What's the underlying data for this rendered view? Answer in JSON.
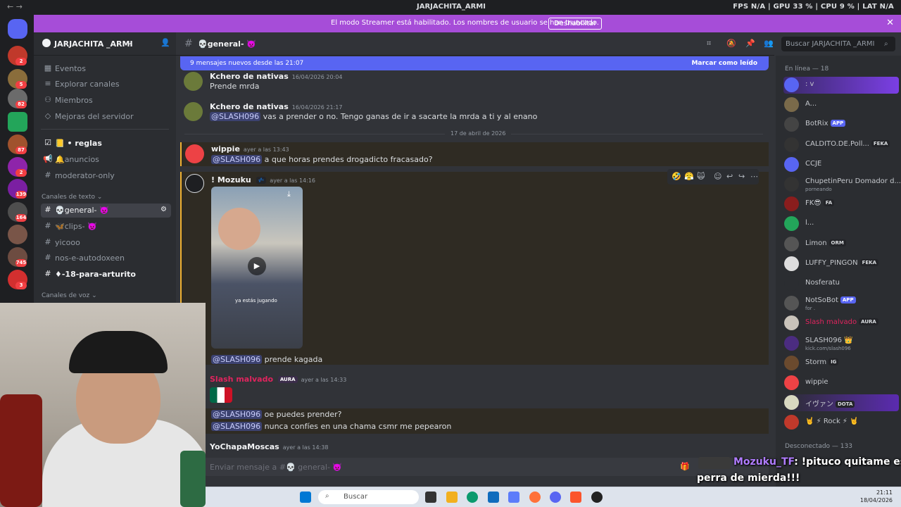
{
  "window": {
    "title": "JARJACHITA_ARMI",
    "stats": "FPS N/A | GPU 33 % | CPU 9 % | LAT N/A"
  },
  "banner": {
    "text": "El modo Streamer está habilitado. Los nombres de usuario se han truncado.",
    "button": "Deshabilitar"
  },
  "server": {
    "name": "JARJACHITA _ARMI",
    "badges": [
      "2",
      "5",
      "82",
      "87",
      "2",
      "139",
      "164",
      "745",
      "3"
    ]
  },
  "sidebar": {
    "top_items": [
      {
        "icon": "calendar-icon",
        "label": "Eventos"
      },
      {
        "icon": "compass-icon",
        "label": "Explorar canales"
      },
      {
        "icon": "members-icon",
        "label": "Miembros"
      },
      {
        "icon": "boost-icon",
        "label": "Mejoras del servidor"
      }
    ],
    "channels_top": [
      {
        "icon": "rules-icon",
        "label": "📒 • reglas"
      },
      {
        "icon": "announce-icon",
        "label": "🔔anuncios"
      },
      {
        "icon": "hash-icon",
        "label": "moderator-only"
      }
    ],
    "text_category": "Canales de texto",
    "text_channels": [
      "💀general- 👿",
      "🦋clips- 👿",
      "yicooo",
      "nos-e-autodoxeen",
      "♦-18-para-arturito"
    ],
    "voice_category": "Canales de voz"
  },
  "channel": {
    "name": "💀general- 👿",
    "search_placeholder": "Buscar JARJACHITA _ARMI"
  },
  "new_messages": {
    "text": "9 mensajes nuevos desde las 21:07",
    "action": "Marcar como leído"
  },
  "messages": [
    {
      "user": "Kchero de nativas",
      "time": "16/04/2026 20:04",
      "text": "Prende mrda"
    },
    {
      "user": "Kchero de nativas",
      "time": "16/04/2026 21:17",
      "mention": "@SLASH096",
      "text": "vas a prender o no. Tengo ganas de ir a sacarte la mrda a ti y al enano"
    },
    {
      "user": "wippie",
      "time": "ayer a las 13:43",
      "mention": "@SLASH096",
      "text": "a que horas prendes drogadicto fracasado?"
    },
    {
      "user": "! Mozuku",
      "badge": "💤",
      "time": "ayer a las 14:16",
      "video_caption": "ya estás jugando",
      "mention": "@SLASH096",
      "text": "prende kagada"
    },
    {
      "user": "Slash malvado",
      "badge": "AURA",
      "time": "ayer a las 14:33",
      "lines": [
        {
          "mention": "@SLASH096",
          "text": "oe puedes prender?"
        },
        {
          "mention": "@SLASH096",
          "text": "nunca confíes en una chama csmr me pepearon"
        }
      ]
    },
    {
      "user": "YoChapaMoscas",
      "time": "ayer a las 14:38"
    }
  ],
  "date_divider": "17 de abril de 2026",
  "composer": {
    "placeholder": "Enviar mensaje a #💀 general- 👿"
  },
  "members": {
    "online_header": "En línea — 18",
    "offline_header": "Desconectado — 133",
    "list": [
      {
        "name": ": v",
        "status": ""
      },
      {
        "name": "A...",
        "status": ""
      },
      {
        "name": "BotRix",
        "tag": "APP"
      },
      {
        "name": "CALDITO.DE.Poll...",
        "tag": "FEKA"
      },
      {
        "name": "CCJE"
      },
      {
        "name": "ChupetinPeru Domador d...",
        "status": "porneando"
      },
      {
        "name": "FK😎",
        "tag": "FA"
      },
      {
        "name": "l..."
      },
      {
        "name": "Limon",
        "tag": "ORM"
      },
      {
        "name": "LUFFY_PINGON",
        "tag": "FEKA"
      },
      {
        "name": "Nosferatu"
      },
      {
        "name": "NotSoBot",
        "tag": "APP",
        "status": "for ."
      },
      {
        "name": "Slash malvado",
        "tag": "AURA"
      },
      {
        "name": "SLASH096 👑",
        "status": "kick.com/slash096"
      },
      {
        "name": "Storm",
        "tag": "IG"
      },
      {
        "name": "wippie"
      },
      {
        "name": "イヴァン",
        "tag": "DOTA"
      },
      {
        "name": "🤘 ⚡ Rock ⚡ 🤘"
      }
    ]
  },
  "stream_overlay": {
    "user": "Mozuku_TF",
    "line1": ": !pituco quitame esa",
    "line2": "perra de mierda!!!"
  },
  "taskbar": {
    "search": "Buscar",
    "time": "21:11",
    "date": "18/04/2026"
  },
  "colors": {
    "accent": "#5865f2",
    "banner": "#a64dd8",
    "highlight": "#f0b232",
    "slash": "#e0245e"
  }
}
